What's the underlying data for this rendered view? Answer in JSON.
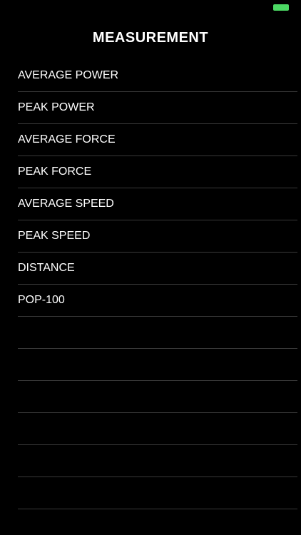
{
  "header": {
    "title": "MEASUREMENT"
  },
  "status_bar": {
    "battery_color": "#4cd964"
  },
  "measurements": [
    {
      "label": "AVERAGE POWER"
    },
    {
      "label": "PEAK POWER"
    },
    {
      "label": "AVERAGE FORCE"
    },
    {
      "label": "PEAK FORCE"
    },
    {
      "label": "AVERAGE SPEED"
    },
    {
      "label": "PEAK SPEED"
    },
    {
      "label": "DISTANCE"
    },
    {
      "label": "POP-100"
    },
    {
      "label": ""
    },
    {
      "label": ""
    },
    {
      "label": ""
    },
    {
      "label": ""
    },
    {
      "label": ""
    },
    {
      "label": ""
    }
  ]
}
